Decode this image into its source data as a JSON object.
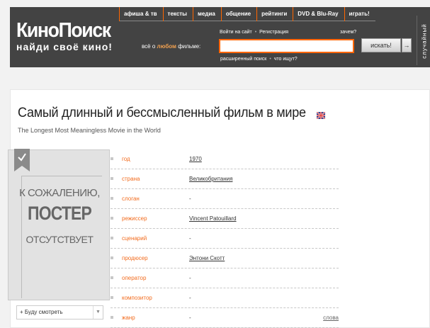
{
  "header": {
    "logo_main": "КиноПоиск",
    "logo_tagline": "найди своё кино!",
    "nav": [
      "афиша & тв",
      "тексты",
      "медиа",
      "общение",
      "рейтинги",
      "DVD & Blu-Ray",
      "играть!"
    ],
    "search_prompt_prefix": "всё о",
    "search_prompt_highlight": "любом",
    "search_prompt_suffix": "фильме:",
    "login_link": "Войти на сайт",
    "separator": "•",
    "register_link": "Регистрация",
    "why_link": "зачем?",
    "search_value": "",
    "search_button": "искать!",
    "arrow_button": "→",
    "advanced_search": "расширенный поиск",
    "what_to_search": "что ищут?",
    "random_label": "случайный"
  },
  "movie": {
    "title": "Самый длинный и бессмысленный фильм в мире",
    "original_title": "The Longest Most Meaningless Movie in the World",
    "poster_text_line1": "К СОЖАЛЕНИЮ,",
    "poster_text_line2": "ПОСТЕР",
    "poster_text_line3": "ОТСУТСТВУЕТ",
    "watch_later": "+ Буду смотреть",
    "watch_dropdown": "▼",
    "info": [
      {
        "label": "год",
        "value": "1970",
        "link": true
      },
      {
        "label": "страна",
        "value": "Великобритания",
        "link": true
      },
      {
        "label": "слоган",
        "value": "-",
        "link": false
      },
      {
        "label": "режиссер",
        "value": "Vincent Patouillard",
        "link": true
      },
      {
        "label": "сценарий",
        "value": "-",
        "link": false
      },
      {
        "label": "продюсер",
        "value": "Энтони Скотт",
        "link": true
      },
      {
        "label": "оператор",
        "value": "-",
        "link": false
      },
      {
        "label": "композитор",
        "value": "-",
        "link": false
      },
      {
        "label": "жанр",
        "value": "-",
        "link": false,
        "extra": "слова"
      }
    ]
  },
  "colors": {
    "header_bg": "#434343",
    "accent": "#ff6600",
    "label": "#f26b1d"
  }
}
